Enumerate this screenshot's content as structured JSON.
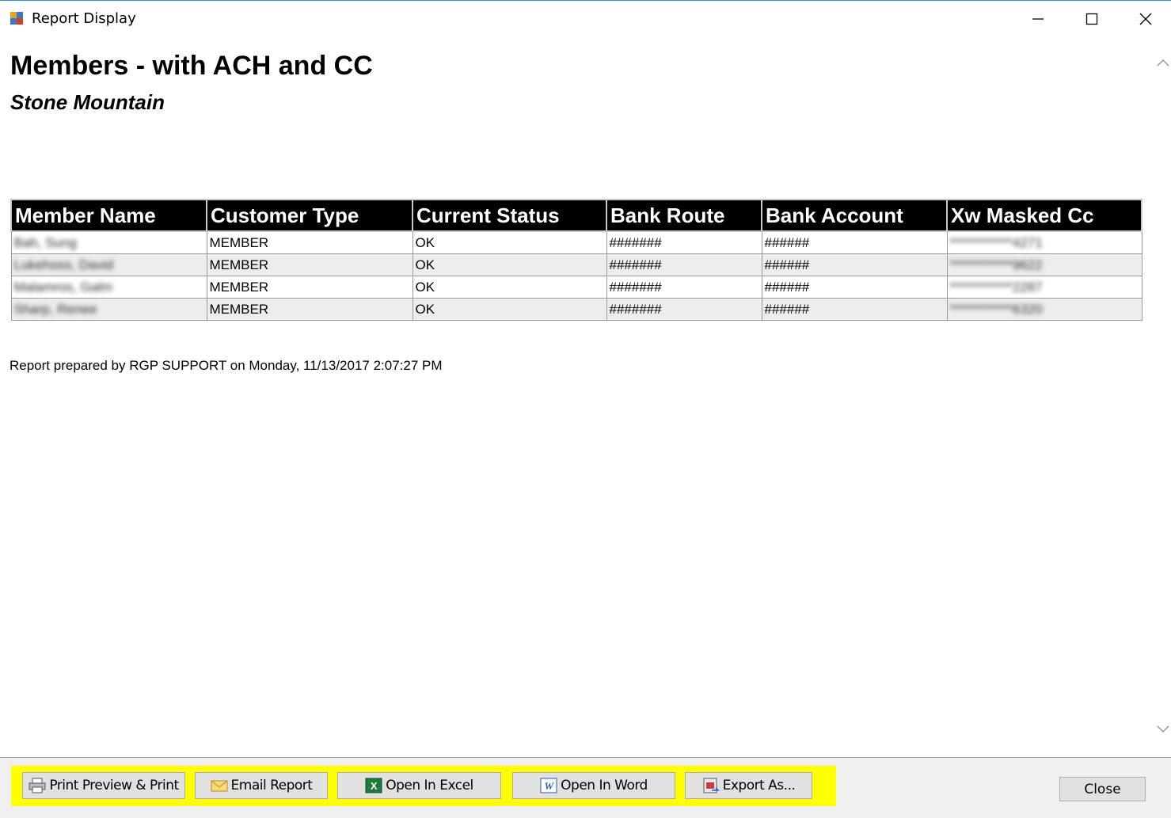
{
  "window": {
    "title": "Report Display"
  },
  "report": {
    "title": "Members - with ACH and CC",
    "subtitle": "Stone Mountain",
    "columns": [
      "Member Name",
      "Customer Type",
      "Current Status",
      "Bank Route",
      "Bank Account",
      "Xw Masked Cc"
    ],
    "rows": [
      [
        "Bah, Sung",
        "MEMBER",
        "OK",
        "#######",
        "######",
        "************4271"
      ],
      [
        "Lukehoss, David",
        "MEMBER",
        "OK",
        "#######",
        "######",
        "************9622"
      ],
      [
        "Malamros, Galm",
        "MEMBER",
        "OK",
        "#######",
        "######",
        "************2287"
      ],
      [
        "Sharp, Renee",
        "MEMBER",
        "OK",
        "#######",
        "######",
        "************6320"
      ]
    ],
    "footer": "Report prepared by RGP SUPPORT on Monday, 11/13/2017 2:07:27 PM"
  },
  "toolbar": {
    "print_label": "Print Preview & Print",
    "email_label": "Email Report",
    "excel_label": "Open In Excel",
    "word_label": "Open In Word",
    "export_label": "Export As...",
    "close_label": "Close"
  },
  "colors": {
    "highlight": "#ffff00",
    "header_bg": "#000000",
    "alt_row": "#ededed"
  }
}
